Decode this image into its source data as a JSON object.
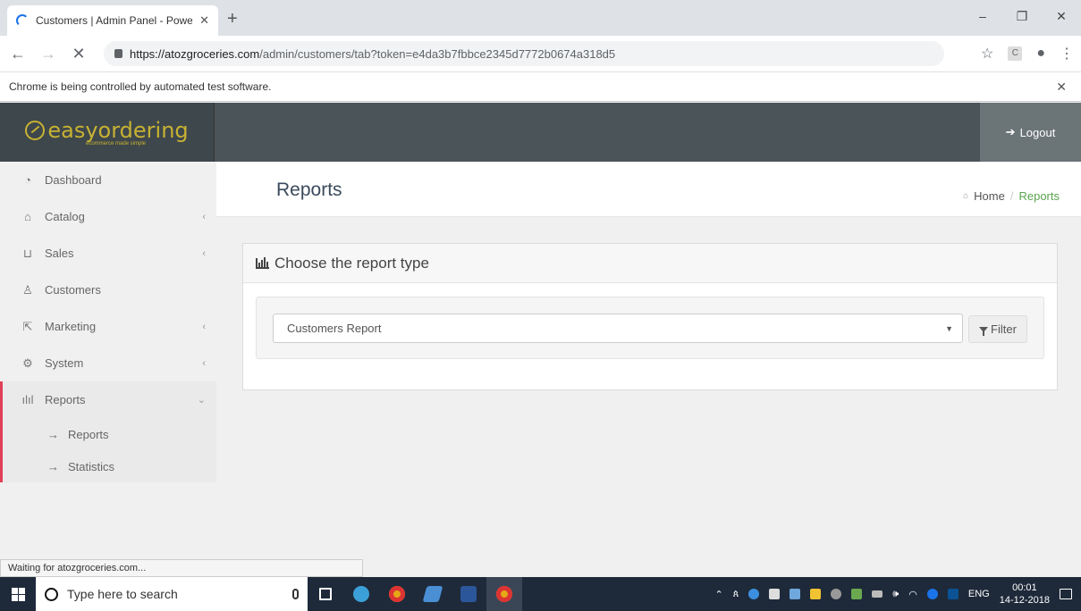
{
  "browser": {
    "tab_title": "Customers | Admin Panel - Powe",
    "url_host": "https://atozgroceries.com",
    "url_path": "/admin/customers/tab?token=e4da3b7fbbce2345d7772b0674a318d5",
    "automation_notice": "Chrome is being controlled by automated test software.",
    "status_text": "Waiting for atozgroceries.com..."
  },
  "header": {
    "logo_text": "easyordering",
    "logo_tagline": "ecommerce made simple",
    "logout_label": "Logout"
  },
  "sidebar": {
    "items": [
      {
        "label": "Dashboard",
        "icon": "dashboard-icon",
        "has_submenu": false
      },
      {
        "label": "Catalog",
        "icon": "tag-icon",
        "has_submenu": true
      },
      {
        "label": "Sales",
        "icon": "cart-icon",
        "has_submenu": true
      },
      {
        "label": "Customers",
        "icon": "user-icon",
        "has_submenu": false
      },
      {
        "label": "Marketing",
        "icon": "share-icon",
        "has_submenu": true
      },
      {
        "label": "System",
        "icon": "gear-icon",
        "has_submenu": true
      },
      {
        "label": "Reports",
        "icon": "bar-chart-icon",
        "has_submenu": true,
        "expanded": true
      }
    ],
    "subitems": [
      {
        "label": "Reports"
      },
      {
        "label": "Statistics"
      }
    ]
  },
  "page": {
    "title": "Reports",
    "breadcrumb_home": "Home",
    "breadcrumb_current": "Reports"
  },
  "panel": {
    "heading": "Choose the report type",
    "select_value": "Customers Report",
    "filter_label": "Filter"
  },
  "taskbar": {
    "search_placeholder": "Type here to search",
    "language": "ENG",
    "time": "00:01",
    "date": "14-12-2018"
  },
  "colors": {
    "accent": "#e0405a",
    "logo": "#c7b233",
    "header_bg": "#4b5559",
    "breadcrumb_active": "#5aa34e"
  }
}
